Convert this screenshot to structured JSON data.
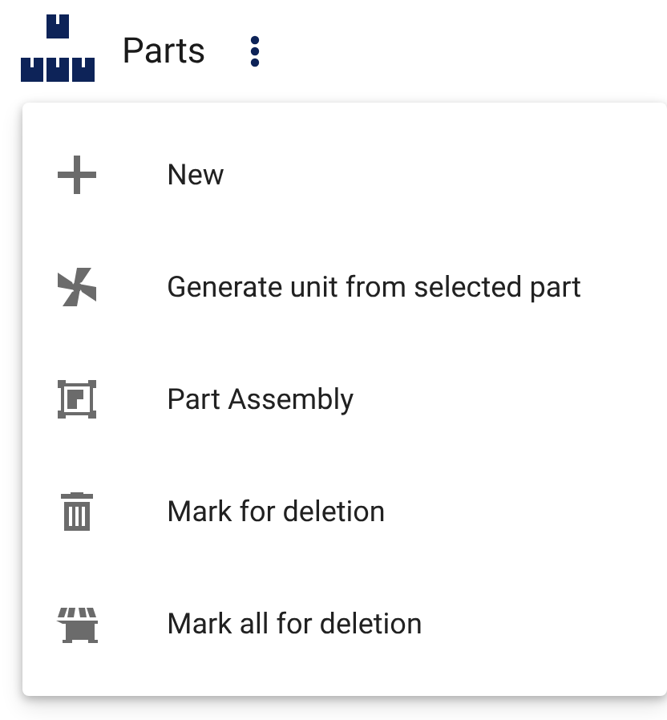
{
  "header": {
    "title": "Parts"
  },
  "menu": {
    "items": [
      {
        "label": "New"
      },
      {
        "label": "Generate unit from selected part"
      },
      {
        "label": "Part Assembly"
      },
      {
        "label": "Mark for deletion"
      },
      {
        "label": "Mark all for deletion"
      }
    ]
  }
}
